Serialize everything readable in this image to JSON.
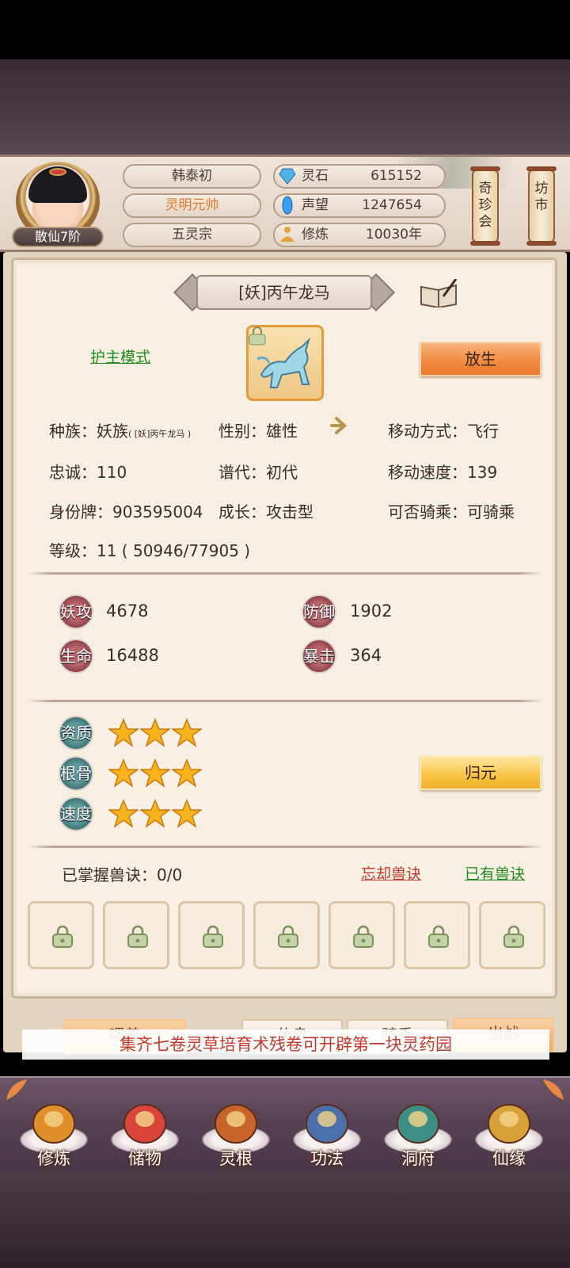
{
  "header": {
    "rank": "散仙7阶",
    "name": "韩泰初",
    "title": "灵明元帅",
    "sect": "五灵宗",
    "stats": [
      {
        "name": "灵石",
        "value": "615152",
        "icon": "spirit-stone-icon"
      },
      {
        "name": "声望",
        "value": "1247654",
        "icon": "prestige-icon"
      },
      {
        "name": "修炼",
        "value": "10030年",
        "icon": "meditation-icon"
      }
    ],
    "shop_treasure": "奇珍会",
    "shop_market": "坊市"
  },
  "pet": {
    "name": "[妖]丙午龙马",
    "mode_link": "护主模式",
    "release_btn": "放生",
    "race_label": "种族：妖族",
    "race_sub": "( [妖]丙午龙马 )",
    "gender": "性别：雄性",
    "move_type": "移动方式：飞行",
    "loyalty": "忠诚：110",
    "generation": "谱代：初代",
    "move_speed": "移动速度：139",
    "id_tag": "身份牌：903595004",
    "growth": "成长：攻击型",
    "rideable": "可否骑乘：可骑乘",
    "level": "等级：11 ( 50946/77905 )"
  },
  "attributes": [
    {
      "label": "妖攻",
      "value": "4678"
    },
    {
      "label": "防御",
      "value": "1902"
    },
    {
      "label": "生命",
      "value": "16488"
    },
    {
      "label": "暴击",
      "value": "364"
    }
  ],
  "qualities": [
    {
      "label": "资质",
      "stars": 3
    },
    {
      "label": "根骨",
      "stars": 3
    },
    {
      "label": "速度",
      "stars": 3
    }
  ],
  "return_btn": "归元",
  "skills": {
    "mastered": "已掌握兽诀：0/0",
    "forget_link": "忘却兽诀",
    "owned_link": "已有兽诀",
    "slots": 7
  },
  "actions": [
    "喂养",
    "休息",
    "骑乘",
    "出战"
  ],
  "notice": "集齐七卷灵草培育术残卷可开辟第一块灵药园",
  "nav": [
    {
      "label": "修炼",
      "icon": "cultivate-icon"
    },
    {
      "label": "储物",
      "icon": "storage-bag-icon"
    },
    {
      "label": "灵根",
      "icon": "spirit-root-icon"
    },
    {
      "label": "功法",
      "icon": "technique-book-icon"
    },
    {
      "label": "洞府",
      "icon": "cave-dwelling-icon"
    },
    {
      "label": "仙缘",
      "icon": "immortal-fate-icon"
    }
  ],
  "colors": {
    "accent_orange": "#f08a3e",
    "link_green": "#1f8a1f",
    "link_red": "#c0392b",
    "title_orange": "#e07a2a"
  }
}
